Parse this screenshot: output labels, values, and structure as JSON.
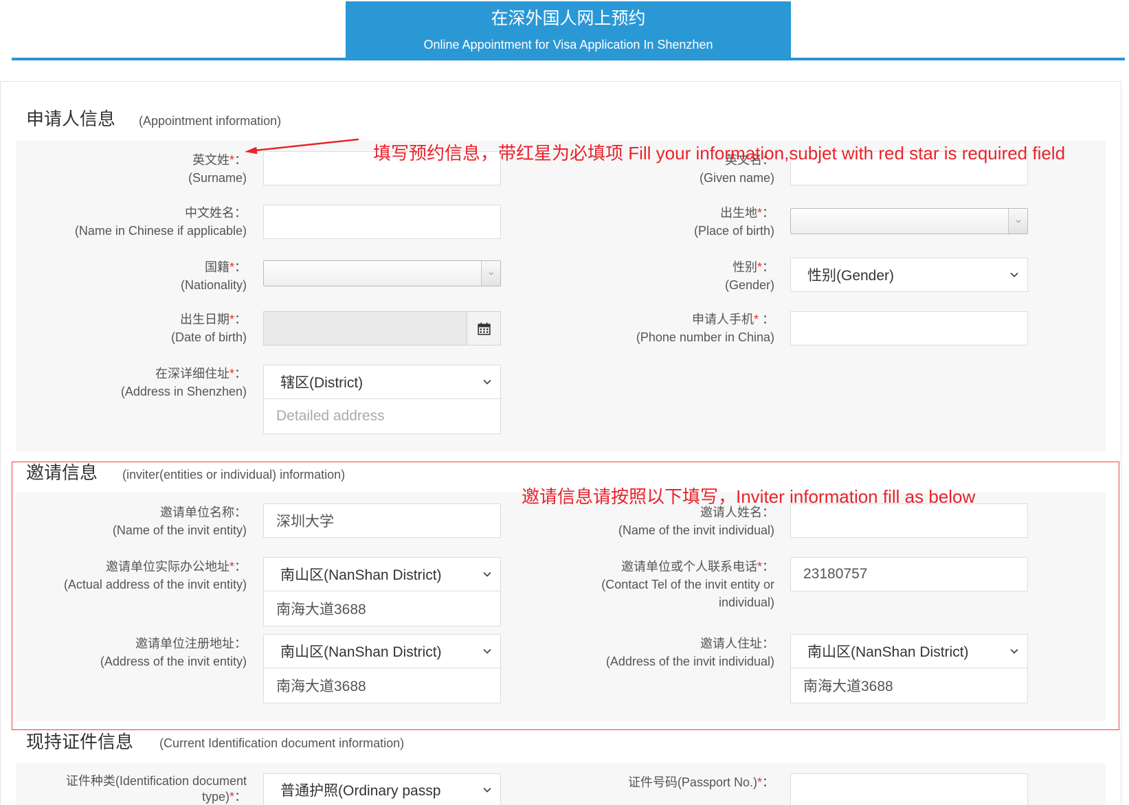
{
  "header": {
    "title": "在深外国人网上预约",
    "subtitle": "Online Appointment for Visa Application In Shenzhen"
  },
  "annotations": {
    "applicant_note": "填写预约信息，带红星为必填项 Fill your information,subjet with red star is required field",
    "inviter_note": "邀请信息请按照以下填写，Inviter information fill as below"
  },
  "applicant": {
    "title": "申请人信息",
    "subtitle": "(Appointment information)",
    "surname": {
      "cn": "英文姓",
      "star": "*",
      "colon": "：",
      "en": "(Surname)",
      "value": ""
    },
    "given_name": {
      "cn": "英文名",
      "colon": "：",
      "en": "(Given name)",
      "value": ""
    },
    "chinese_name": {
      "cn": "中文姓名",
      "colon": "：",
      "en": "(Name in Chinese if applicable)",
      "value": ""
    },
    "place_of_birth": {
      "cn": "出生地",
      "star": "*",
      "colon": "：",
      "en": "(Place of birth)",
      "selected": ""
    },
    "nationality": {
      "cn": "国籍",
      "star": "*",
      "colon": "：",
      "en": "(Nationality)",
      "selected": ""
    },
    "gender": {
      "cn": "性别",
      "star": "*",
      "colon": "：",
      "en": "(Gender)",
      "selected": "性别(Gender)"
    },
    "date_of_birth": {
      "cn": "出生日期",
      "star": "*",
      "colon": "：",
      "en": "(Date of birth)",
      "value": ""
    },
    "phone": {
      "cn": "申请人手机",
      "star": "*",
      "colon": " ：",
      "en": "(Phone number in China)",
      "value": ""
    },
    "address": {
      "cn": "在深详细住址",
      "star": "*",
      "colon": "：",
      "en": "(Address in Shenzhen)",
      "district_selected": "辖区(District)",
      "detail_placeholder": "Detailed address",
      "detail_value": ""
    }
  },
  "inviter": {
    "title": "邀请信息",
    "subtitle": "(inviter(entities or individual) information)",
    "entity_name": {
      "cn": "邀请单位名称",
      "colon": "：",
      "en": "(Name of the invit entity)",
      "value": "深圳大学"
    },
    "individual_name": {
      "cn": "邀请人姓名",
      "colon": "：",
      "en": "(Name of the invit individual)",
      "value": ""
    },
    "entity_office_address": {
      "cn": "邀请单位实际办公地址",
      "star": "*",
      "colon": "：",
      "en": "(Actual address of the invit entity)",
      "district_selected": "南山区(NanShan District)",
      "detail_value": "南海大道3688"
    },
    "contact_tel": {
      "cn": "邀请单位或个人联系电话",
      "star": "*",
      "colon": "：",
      "en_line1": "(Contact Tel of the invit entity or",
      "en_line2": "individual)",
      "value": "23180757"
    },
    "entity_registered_address": {
      "cn": "邀请单位注册地址",
      "colon": "：",
      "en": "(Address of the invit entity)",
      "district_selected": "南山区(NanShan District)",
      "detail_value": "南海大道3688"
    },
    "individual_address": {
      "cn": "邀请人住址",
      "colon": "：",
      "en": "(Address of the invit individual)",
      "district_selected": "南山区(NanShan District)",
      "detail_value": "南海大道3688"
    }
  },
  "document": {
    "title": "现持证件信息",
    "subtitle": "(Current Identification document information)",
    "doc_type": {
      "line1": "证件种类(Identification document",
      "line2": "type)",
      "star": "*",
      "colon": "：",
      "selected": "普通护照(Ordinary passp"
    },
    "passport_no": {
      "cn": "证件号码(Passport No.)",
      "star": "*",
      "colon": "：",
      "value": ""
    }
  },
  "theme": {
    "header_blue": "#2b98d6",
    "annotation_red": "#e8232a",
    "required_red": "#e5322d",
    "panel_gray": "#f7f7f7",
    "frame_red": "#e8413c"
  }
}
